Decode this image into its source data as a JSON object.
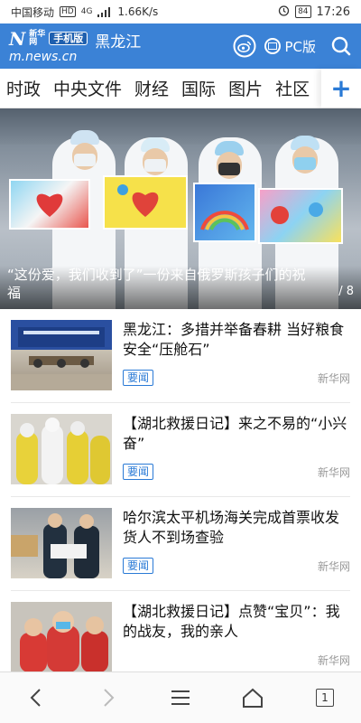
{
  "status": {
    "carrier": "中国移动",
    "hd": "HD",
    "network": "4G",
    "speed": "1.66K/s",
    "battery": "84",
    "time": "17:26"
  },
  "header": {
    "logo_brand": "新华网",
    "logo_badge": "手机版",
    "logo_url": "m.news.cn",
    "region": "黑龙江",
    "pc_label": "PC版",
    "accent": "#3b82d6"
  },
  "tabs": [
    "时政",
    "中央文件",
    "财经",
    "国际",
    "图片",
    "社区"
  ],
  "tabs_more": "+",
  "hero": {
    "caption": "“这份爱，我们收到了”一份来自俄罗斯孩子们的祝福",
    "counter": "/ 8"
  },
  "news": [
    {
      "title": "黑龙江：多措并举备春耕 当好粮食安全“压舱石”",
      "tag": "要闻",
      "source": "新华网",
      "thumb": "meeting"
    },
    {
      "title": "【湖北救援日记】来之不易的“小兴奋”",
      "tag": "要闻",
      "source": "新华网",
      "thumb": "medics-yellow"
    },
    {
      "title": "哈尔滨太平机场海关完成首票收发货人不到场查验",
      "tag": "要闻",
      "source": "新华网",
      "thumb": "customs"
    },
    {
      "title": "【湖北救援日记】点赞“宝贝”：我的战友，我的亲人",
      "tag": "",
      "source": "新华网",
      "thumb": "nurses-red"
    }
  ],
  "bottom": {
    "tab_count": "1",
    "icons": [
      "back-icon",
      "forward-icon",
      "menu-icon",
      "home-icon",
      "tabs-icon"
    ]
  }
}
